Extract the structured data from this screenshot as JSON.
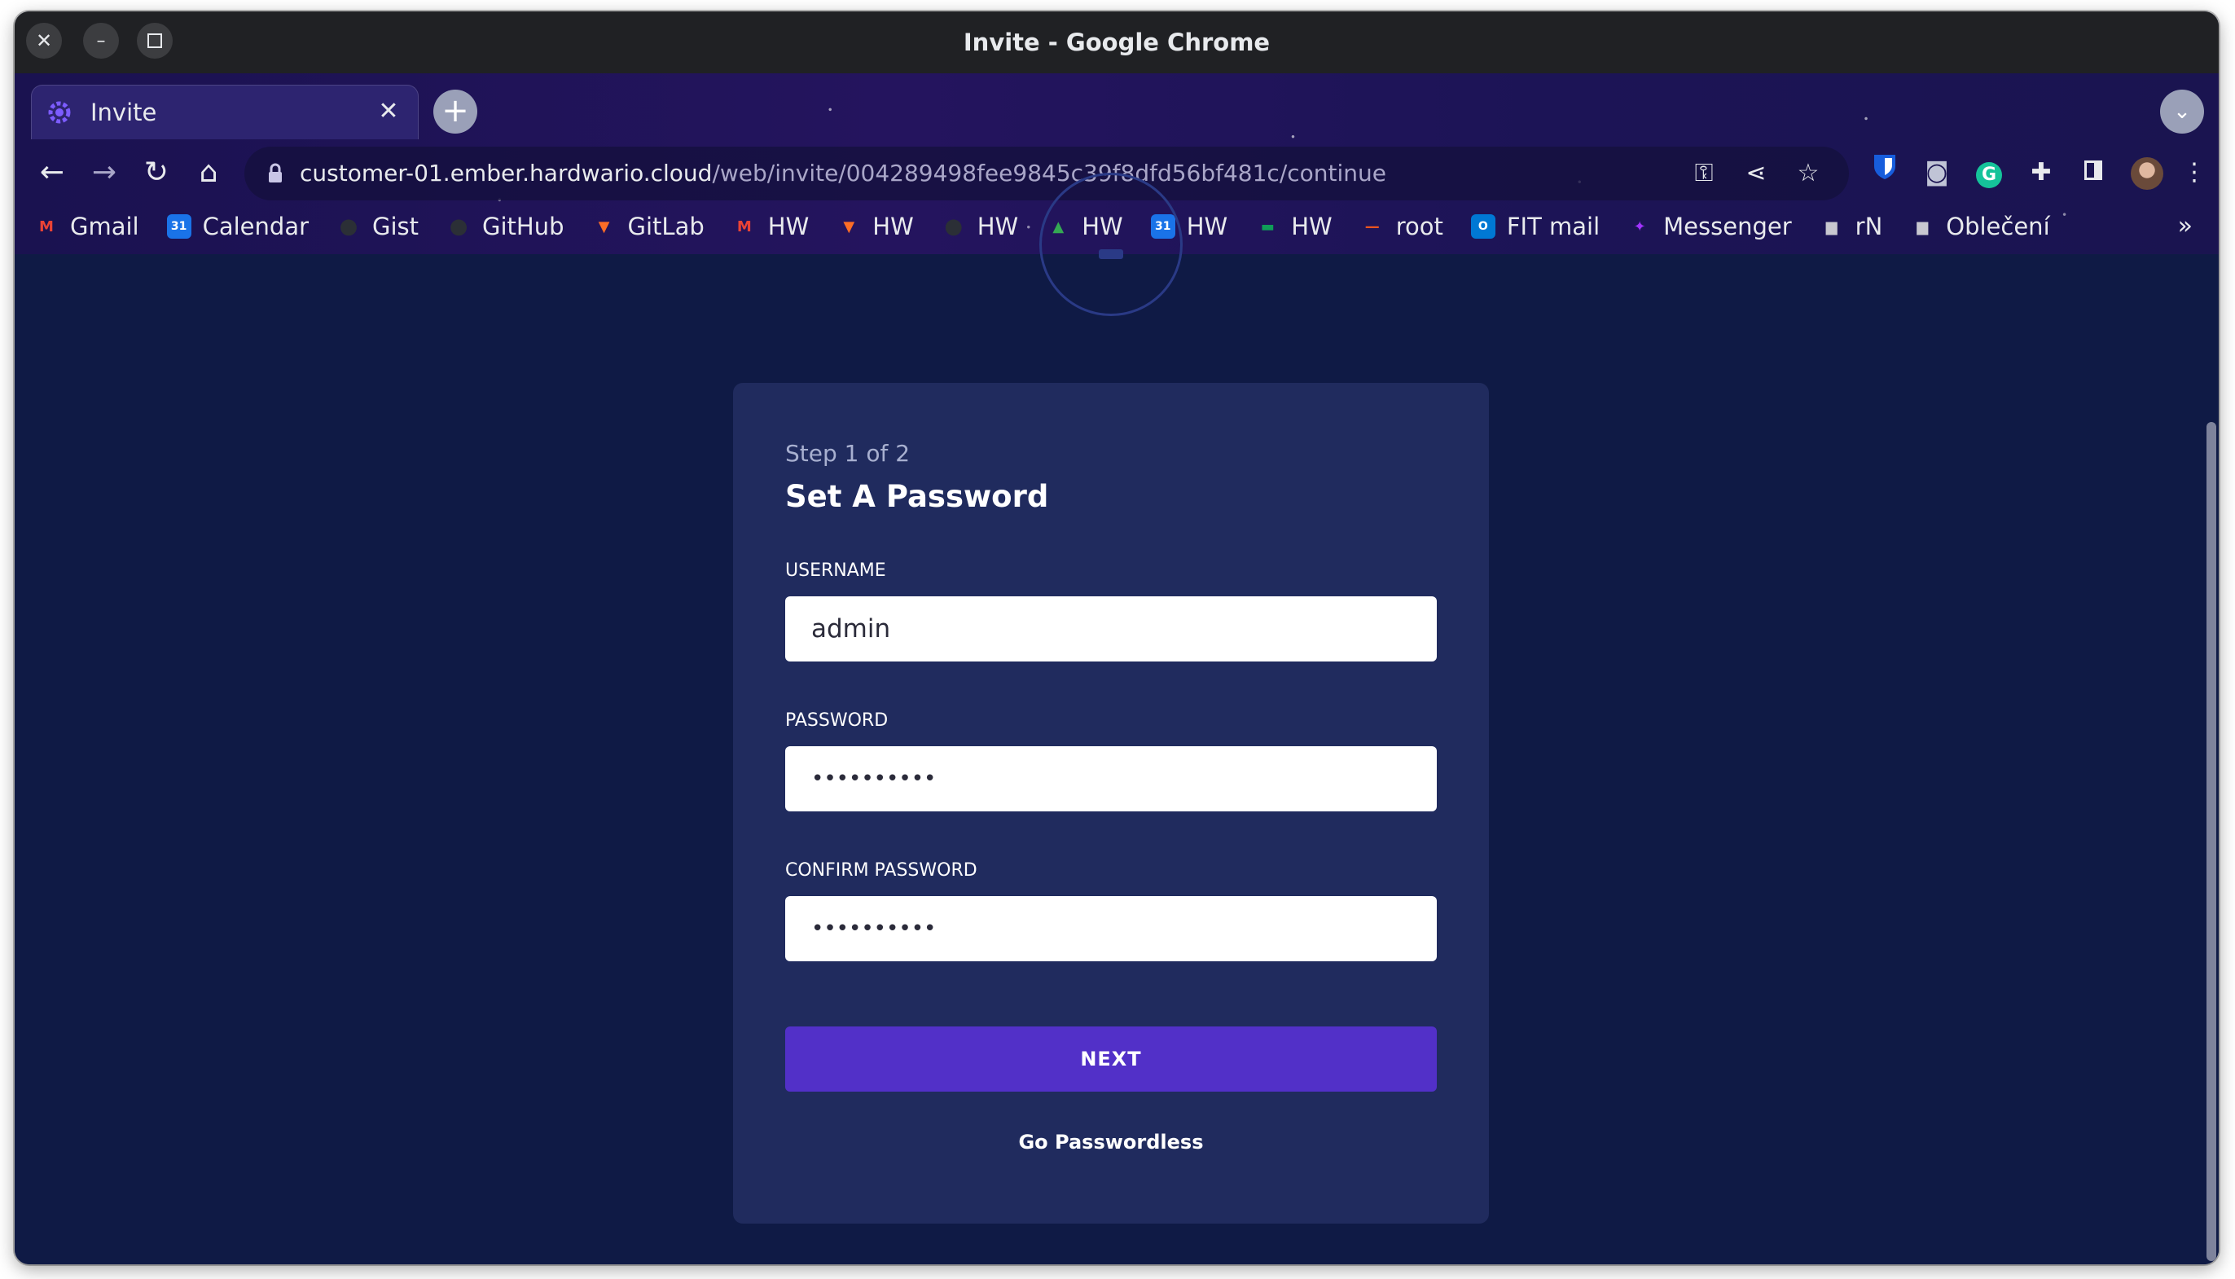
{
  "window": {
    "title": "Invite - Google Chrome"
  },
  "tab": {
    "title": "Invite"
  },
  "omnibox": {
    "url_host": "customer-01.ember.hardwario.cloud",
    "url_path": "/web/invite/004289498fee9845c39f8dfd56bf481c/continue"
  },
  "bookmarks": [
    {
      "label": "Gmail",
      "icon": "gmail-icon",
      "color": "#ea4335"
    },
    {
      "label": "Calendar",
      "icon": "calendar-icon",
      "color": "#1a73e8"
    },
    {
      "label": "Gist",
      "icon": "github-icon",
      "color": "#24292f"
    },
    {
      "label": "GitHub",
      "icon": "github-icon",
      "color": "#24292f"
    },
    {
      "label": "GitLab",
      "icon": "gitlab-icon",
      "color": "#fc6d26"
    },
    {
      "label": "HW",
      "icon": "gmail-icon",
      "color": "#ea4335"
    },
    {
      "label": "HW",
      "icon": "gitlab-icon",
      "color": "#fc6d26"
    },
    {
      "label": "HW",
      "icon": "github-icon",
      "color": "#24292f"
    },
    {
      "label": "HW",
      "icon": "drive-icon",
      "color": "#34a853"
    },
    {
      "label": "HW",
      "icon": "calendar-icon",
      "color": "#1a73e8"
    },
    {
      "label": "HW",
      "icon": "chat-icon",
      "color": "#0f9d58"
    },
    {
      "label": "root",
      "icon": "terminal-icon",
      "color": "#e95420"
    },
    {
      "label": "FIT mail",
      "icon": "outlook-icon",
      "color": "#0078d4"
    },
    {
      "label": "Messenger",
      "icon": "messenger-icon",
      "color": "#a033ff"
    },
    {
      "label": "rN",
      "icon": "folder-icon",
      "color": "#c8c8d0"
    },
    {
      "label": "Oblečení",
      "icon": "folder-icon",
      "color": "#c8c8d0"
    }
  ],
  "bookmarks_more": "»",
  "form": {
    "step": "Step 1 of 2",
    "heading": "Set A Password",
    "username_label": "USERNAME",
    "username_value": "admin",
    "password_label": "PASSWORD",
    "password_value": "••••••••••",
    "confirm_label": "CONFIRM PASSWORD",
    "confirm_value": "••••••••••",
    "next_label": "NEXT",
    "passwordless_label": "Go Passwordless"
  },
  "colors": {
    "page_bg": "#0f1a45",
    "card_bg": "#202b5e",
    "primary_button": "#5230c8"
  }
}
